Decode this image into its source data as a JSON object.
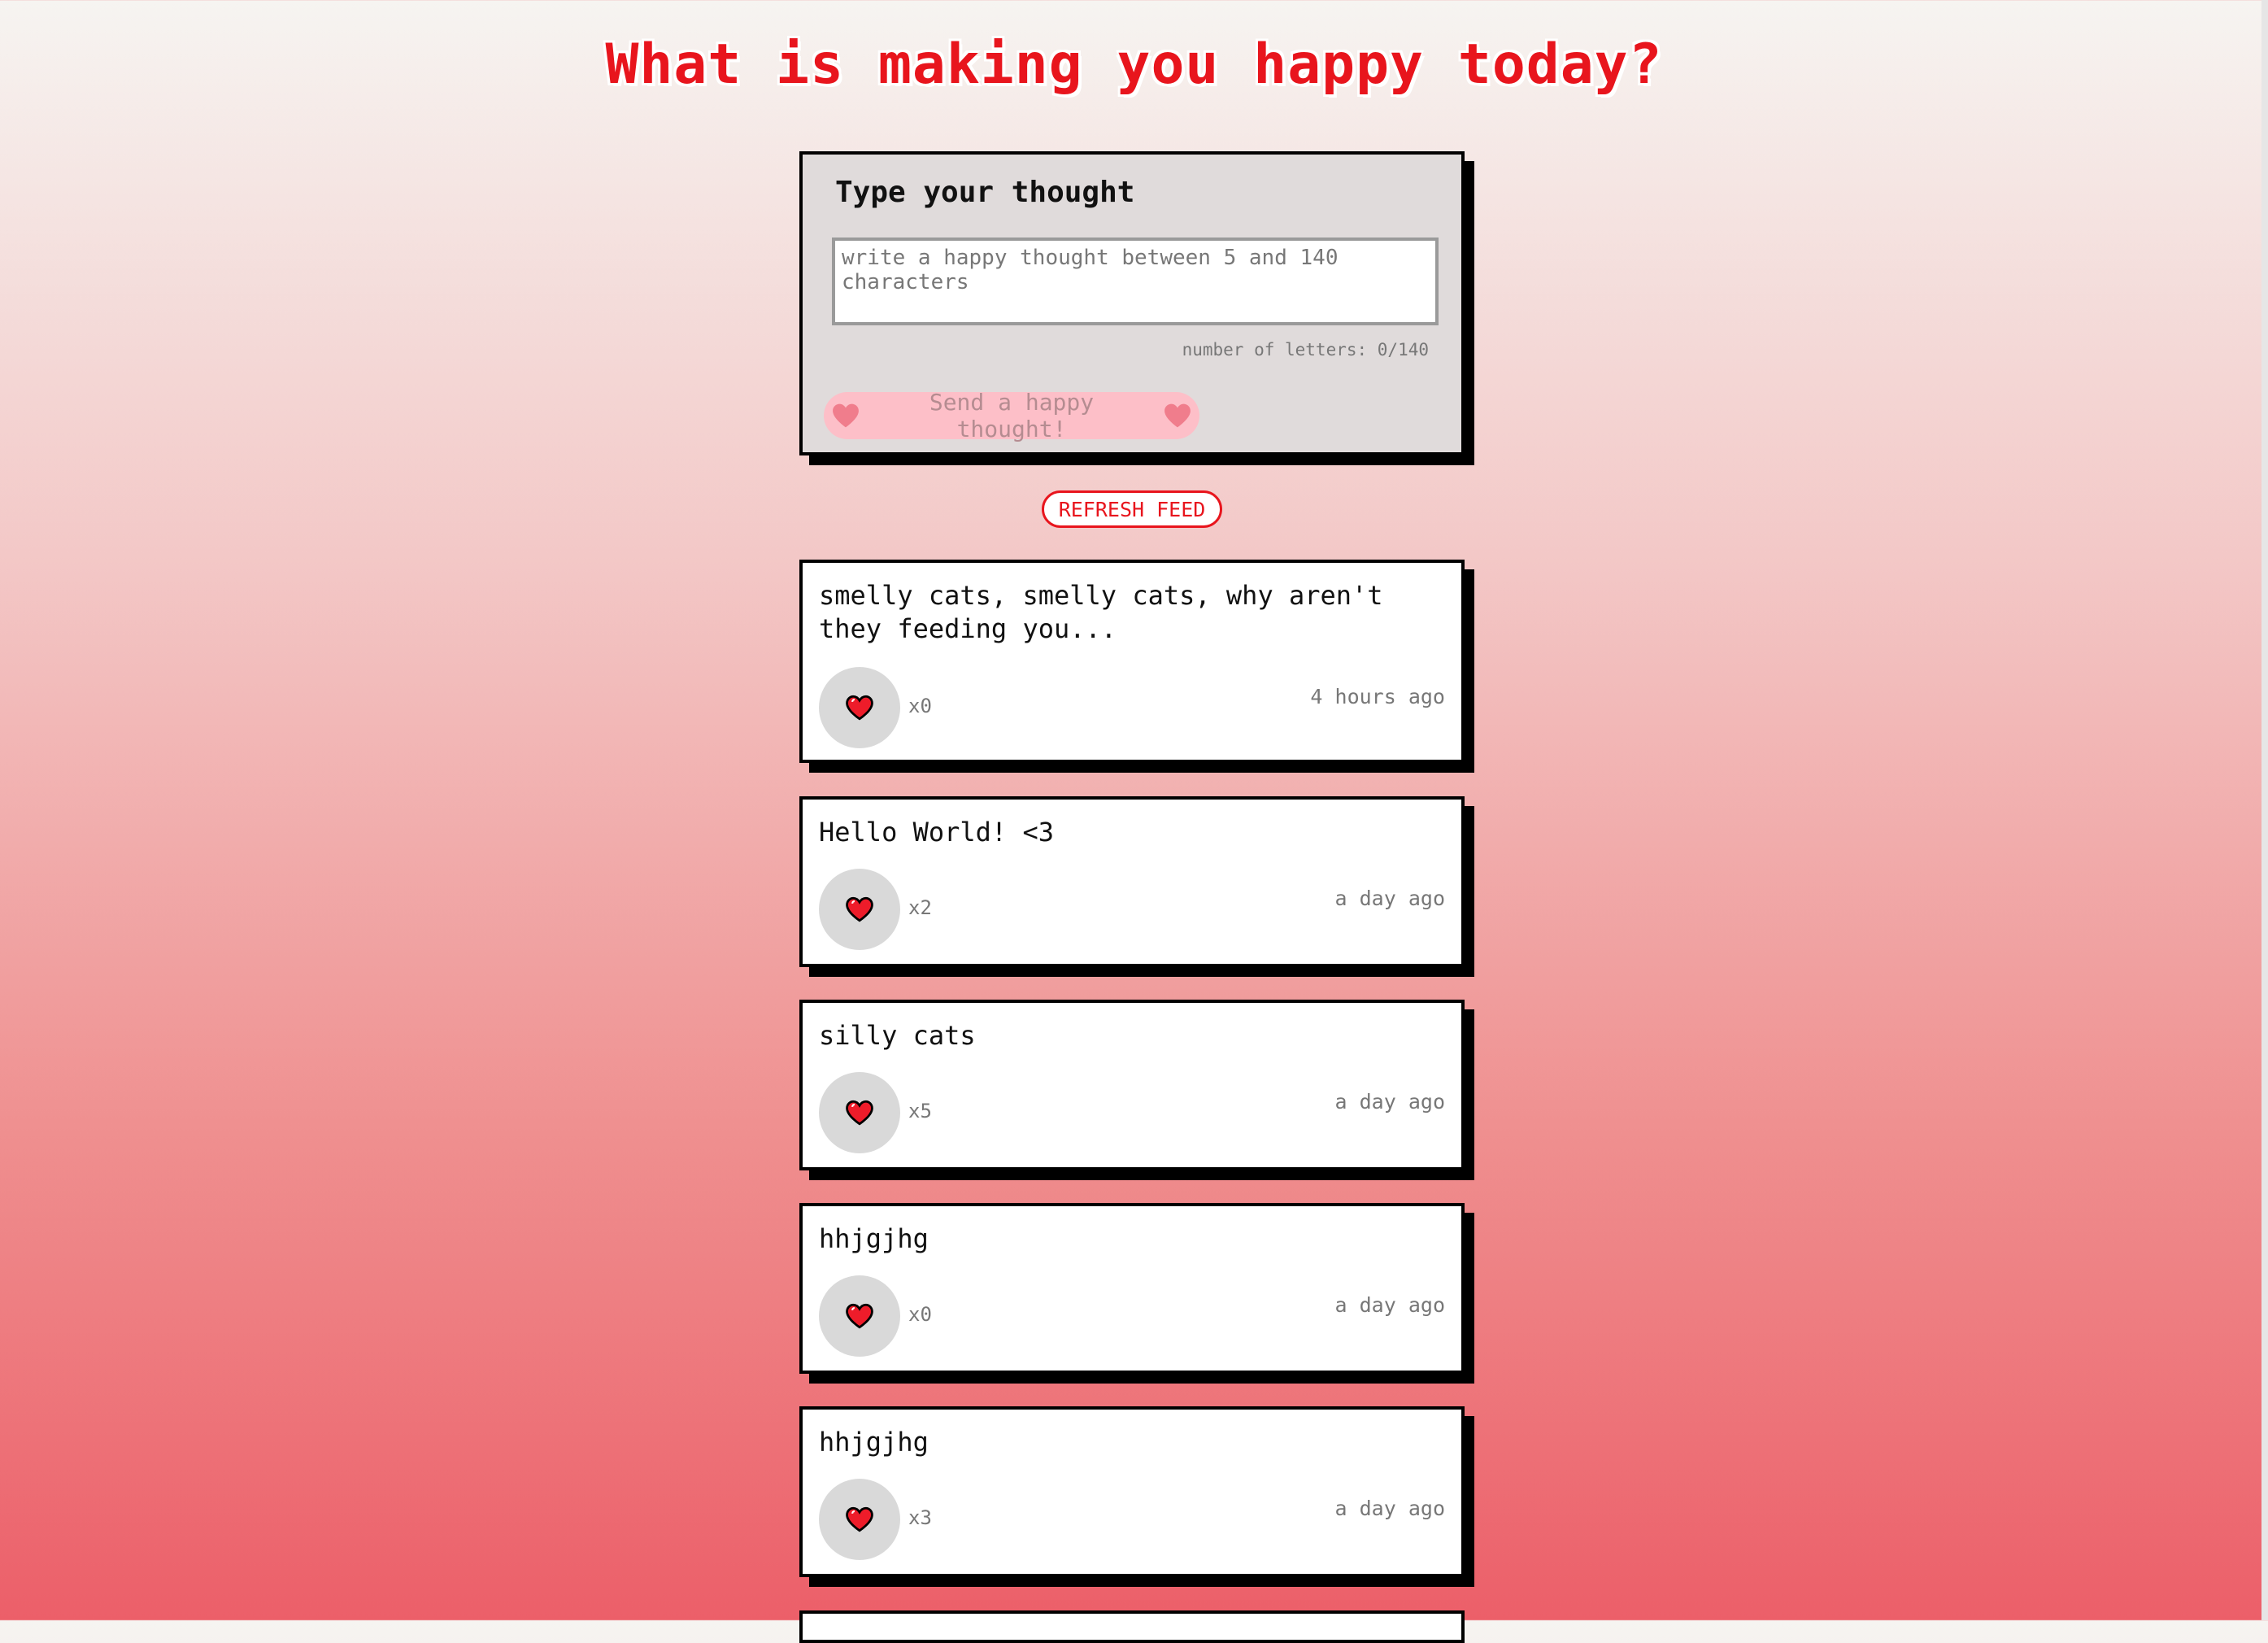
{
  "header": {
    "title": "What is making you happy today?"
  },
  "form": {
    "heading": "Type your thought",
    "placeholder": "write a happy thought between 5 and 140 characters",
    "counter": "number of letters: 0/140",
    "send_label": "Send a happy thought!"
  },
  "refresh_label": "REFRESH FEED",
  "thoughts": [
    {
      "message": "smelly cats, smelly cats, why aren't they feeding you...",
      "likes": "x0",
      "time": "4 hours ago"
    },
    {
      "message": "Hello World! <3",
      "likes": "x2",
      "time": "a day ago"
    },
    {
      "message": "silly cats",
      "likes": "x5",
      "time": "a day ago"
    },
    {
      "message": "hhjgjhg",
      "likes": "x0",
      "time": "a day ago"
    },
    {
      "message": "hhjgjhg",
      "likes": "x3",
      "time": "a day ago"
    }
  ],
  "colors": {
    "accent_red": "#e8151d",
    "heart_red": "#ee1c2a",
    "send_pink": "#fdbfc8",
    "card_gray": "#e0dbdb"
  },
  "icons": {
    "like": "heart-icon",
    "send": "heart-icon"
  }
}
